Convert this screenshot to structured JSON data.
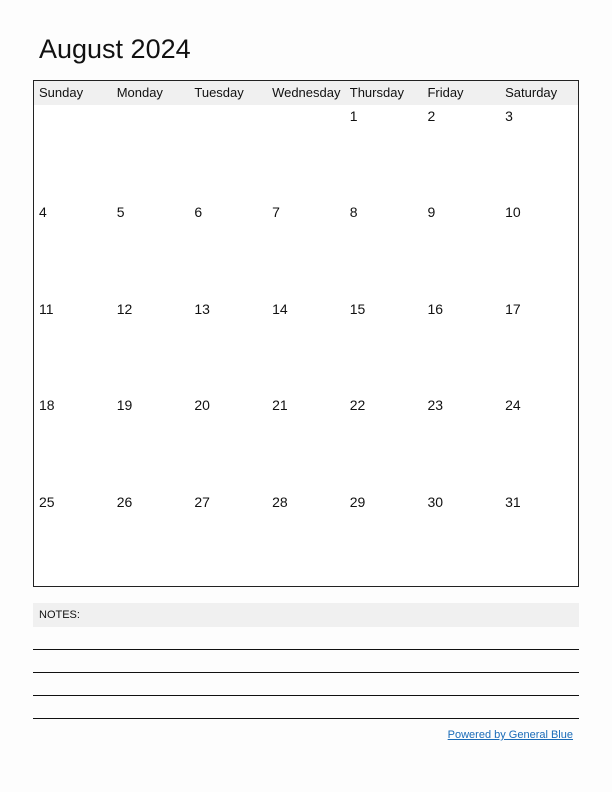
{
  "title": "August 2024",
  "weekdays": [
    "Sunday",
    "Monday",
    "Tuesday",
    "Wednesday",
    "Thursday",
    "Friday",
    "Saturday"
  ],
  "weeks": [
    [
      "",
      "",
      "",
      "",
      "1",
      "2",
      "3"
    ],
    [
      "4",
      "5",
      "6",
      "7",
      "8",
      "9",
      "10"
    ],
    [
      "11",
      "12",
      "13",
      "14",
      "15",
      "16",
      "17"
    ],
    [
      "18",
      "19",
      "20",
      "21",
      "22",
      "23",
      "24"
    ],
    [
      "25",
      "26",
      "27",
      "28",
      "29",
      "30",
      "31"
    ]
  ],
  "notes_label": "NOTES:",
  "footer_link": "Powered by General Blue"
}
